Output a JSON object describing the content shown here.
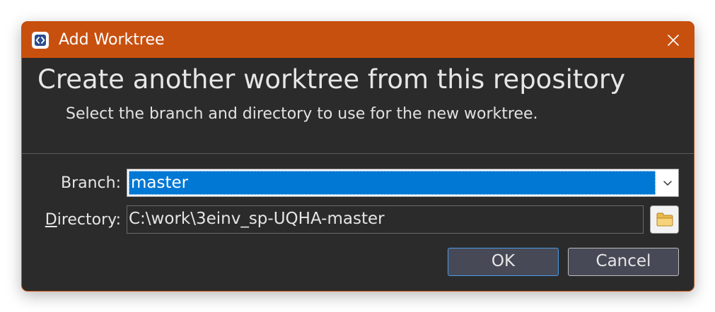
{
  "window": {
    "title": "Add Worktree",
    "accent_color": "#c8500f",
    "app_icon": "code-brackets-icon",
    "close_icon": "close-icon"
  },
  "header": {
    "title": "Create another worktree from this repository",
    "subtitle": "Select the branch and directory to use for the new worktree."
  },
  "form": {
    "branch_label": "Branch:",
    "branch_value": "master",
    "directory_label_accel": "D",
    "directory_label_rest": "irectory:",
    "directory_value": "C:\\work\\3einv_sp-UQHA-master",
    "browse_icon": "folder-icon",
    "dropdown_icon": "chevron-down-icon"
  },
  "buttons": {
    "ok_label": "OK",
    "cancel_label": "Cancel"
  }
}
